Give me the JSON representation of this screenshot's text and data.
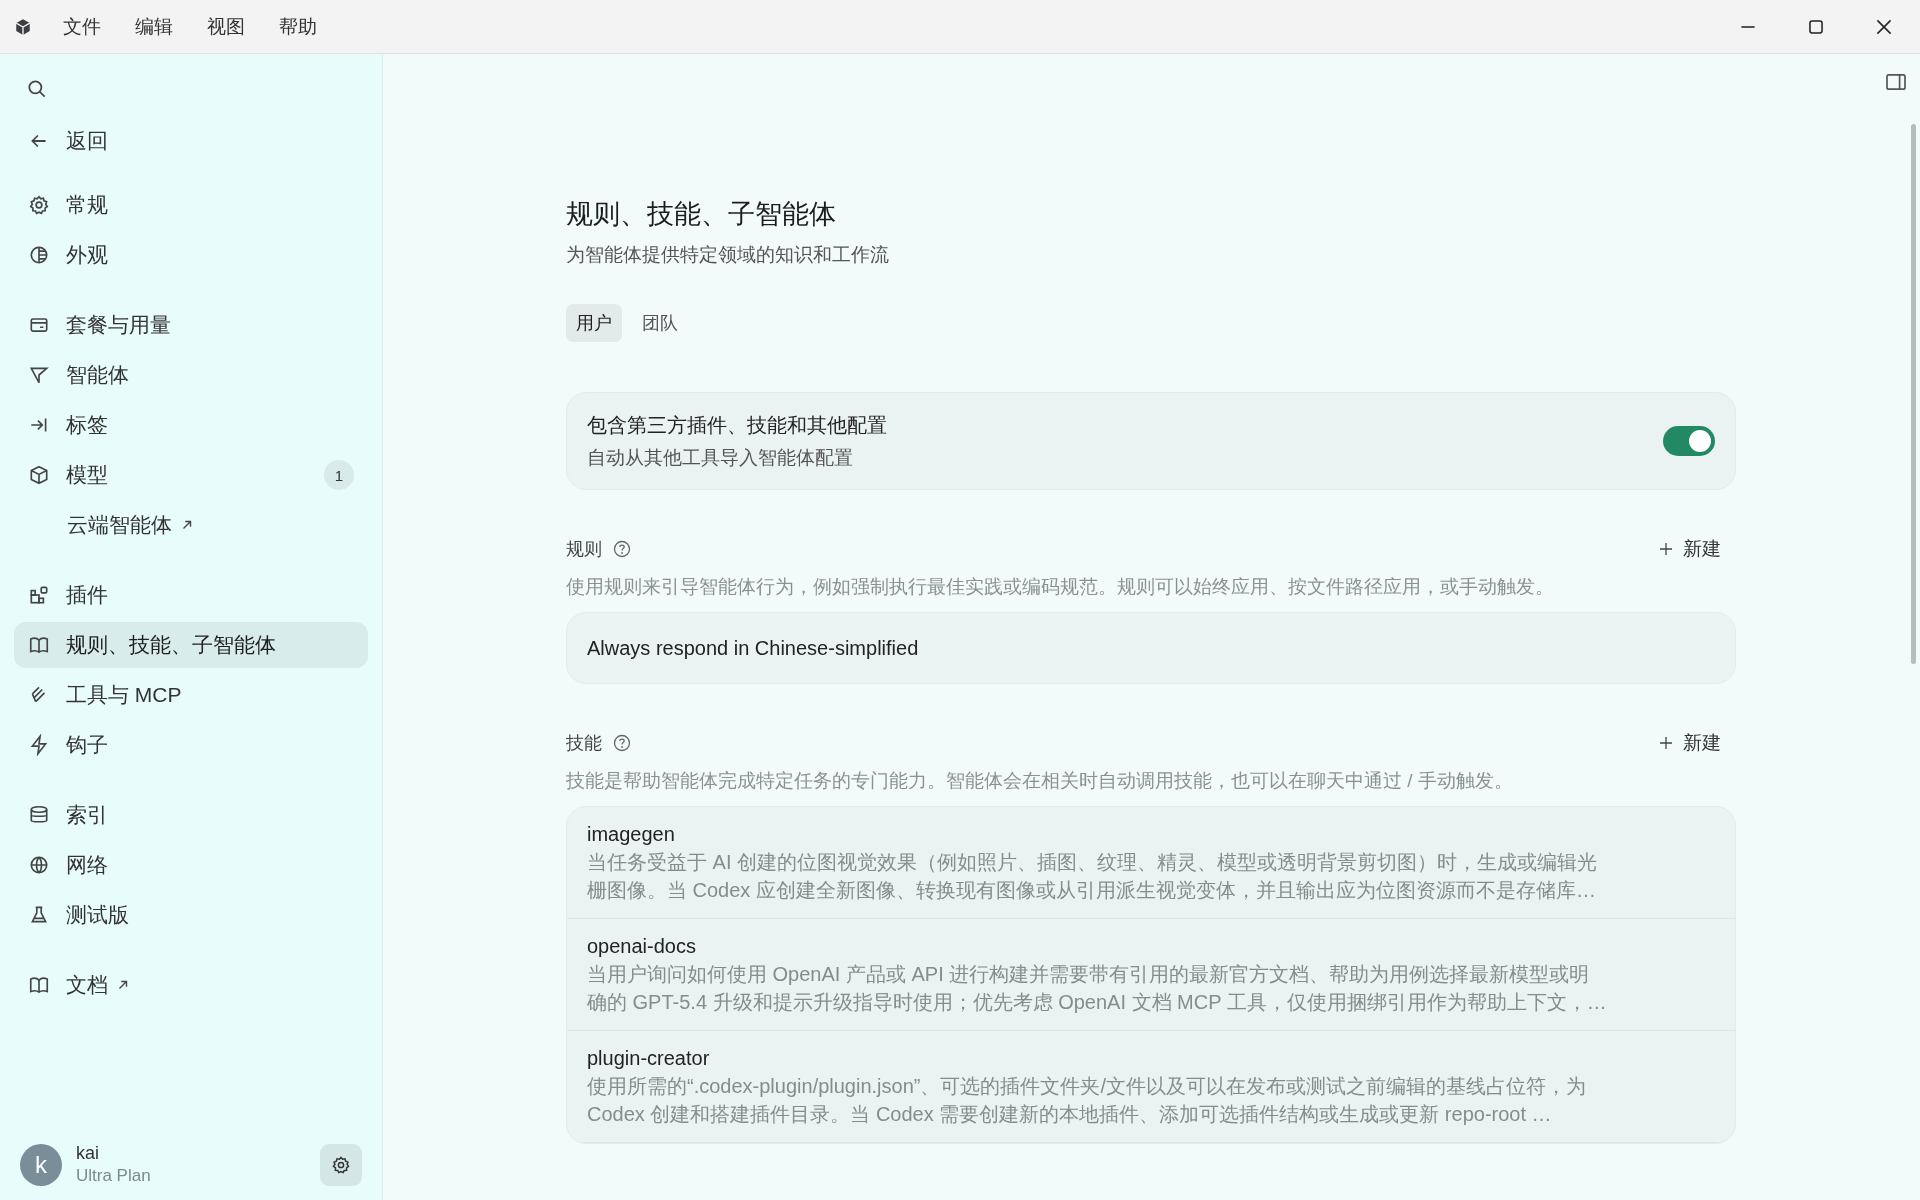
{
  "window": {
    "menu": [
      "文件",
      "编辑",
      "视图",
      "帮助"
    ]
  },
  "sidebar": {
    "back": "返回",
    "groups": [
      {
        "items": [
          {
            "label": "常规",
            "selected": false,
            "kind": "nav"
          },
          {
            "label": "外观",
            "selected": false,
            "kind": "nav"
          }
        ]
      },
      {
        "items": [
          {
            "label": "套餐与用量",
            "selected": false,
            "kind": "nav"
          },
          {
            "label": "智能体",
            "selected": false,
            "kind": "nav"
          },
          {
            "label": "标签",
            "selected": false,
            "kind": "nav"
          },
          {
            "label": "模型",
            "selected": false,
            "kind": "nav",
            "badge": "1"
          },
          {
            "label": "云端智能体",
            "selected": false,
            "kind": "sublink"
          }
        ]
      },
      {
        "items": [
          {
            "label": "插件",
            "selected": false,
            "kind": "nav"
          },
          {
            "label": "规则、技能、子智能体",
            "selected": true,
            "kind": "nav"
          },
          {
            "label": "工具与 MCP",
            "selected": false,
            "kind": "nav"
          },
          {
            "label": "钩子",
            "selected": false,
            "kind": "nav"
          }
        ]
      },
      {
        "items": [
          {
            "label": "索引",
            "selected": false,
            "kind": "nav"
          },
          {
            "label": "网络",
            "selected": false,
            "kind": "nav"
          },
          {
            "label": "测试版",
            "selected": false,
            "kind": "nav"
          }
        ]
      },
      {
        "items": [
          {
            "label": "文档",
            "selected": false,
            "kind": "link"
          }
        ]
      }
    ],
    "user": {
      "initial": "k",
      "name": "kai",
      "plan": "Ultra Plan"
    }
  },
  "page": {
    "title": "规则、技能、子智能体",
    "subtitle": "为智能体提供特定领域的知识和工作流",
    "tabs": [
      {
        "label": "用户",
        "selected": true
      },
      {
        "label": "团队",
        "selected": false
      }
    ],
    "import_setting": {
      "title": "包含第三方插件、技能和其他配置",
      "description": "自动从其他工具导入智能体配置",
      "on": true
    },
    "sections": [
      {
        "title": "规则",
        "action": "新建",
        "description": "使用规则来引导智能体行为，例如强制执行最佳实践或编码规范。规则可以始终应用、按文件路径应用，或手动触发。",
        "items": [
          {
            "name": "Always respond in Chinese-simplified"
          }
        ]
      },
      {
        "title": "技能",
        "action": "新建",
        "description": "技能是帮助智能体完成特定任务的专门能力。智能体会在相关时自动调用技能，也可以在聊天中通过 / 手动触发。",
        "items": [
          {
            "name": "imagegen",
            "lines": [
              "当任务受益于 AI 创建的位图视觉效果（例如照片、插图、纹理、精灵、模型或透明背景剪切图）时，生成或编辑光",
              "栅图像。当 Codex 应创建全新图像、转换现有图像或从引用派生视觉变体，并且输出应为位图资源而不是存储库…"
            ]
          },
          {
            "name": "openai-docs",
            "lines": [
              "当用户询问如何使用 OpenAI 产品或 API 进行构建并需要带有引用的最新官方文档、帮助为用例选择最新模型或明",
              "确的 GPT-5.4 升级和提示升级指导时使用；优先考虑 OpenAI 文档 MCP 工具，仅使用捆绑引用作为帮助上下文，…"
            ]
          },
          {
            "name": "plugin-creator",
            "lines": [
              "使用所需的“.codex-plugin/plugin.json”、可选的插件文件夹/文件以及可以在发布或测试之前编辑的基线占位符，为",
              "Codex 创建和搭建插件目录。当 Codex 需要创建新的本地插件、添加可选插件结构或生成或更新 repo-root …"
            ]
          }
        ]
      }
    ]
  }
}
